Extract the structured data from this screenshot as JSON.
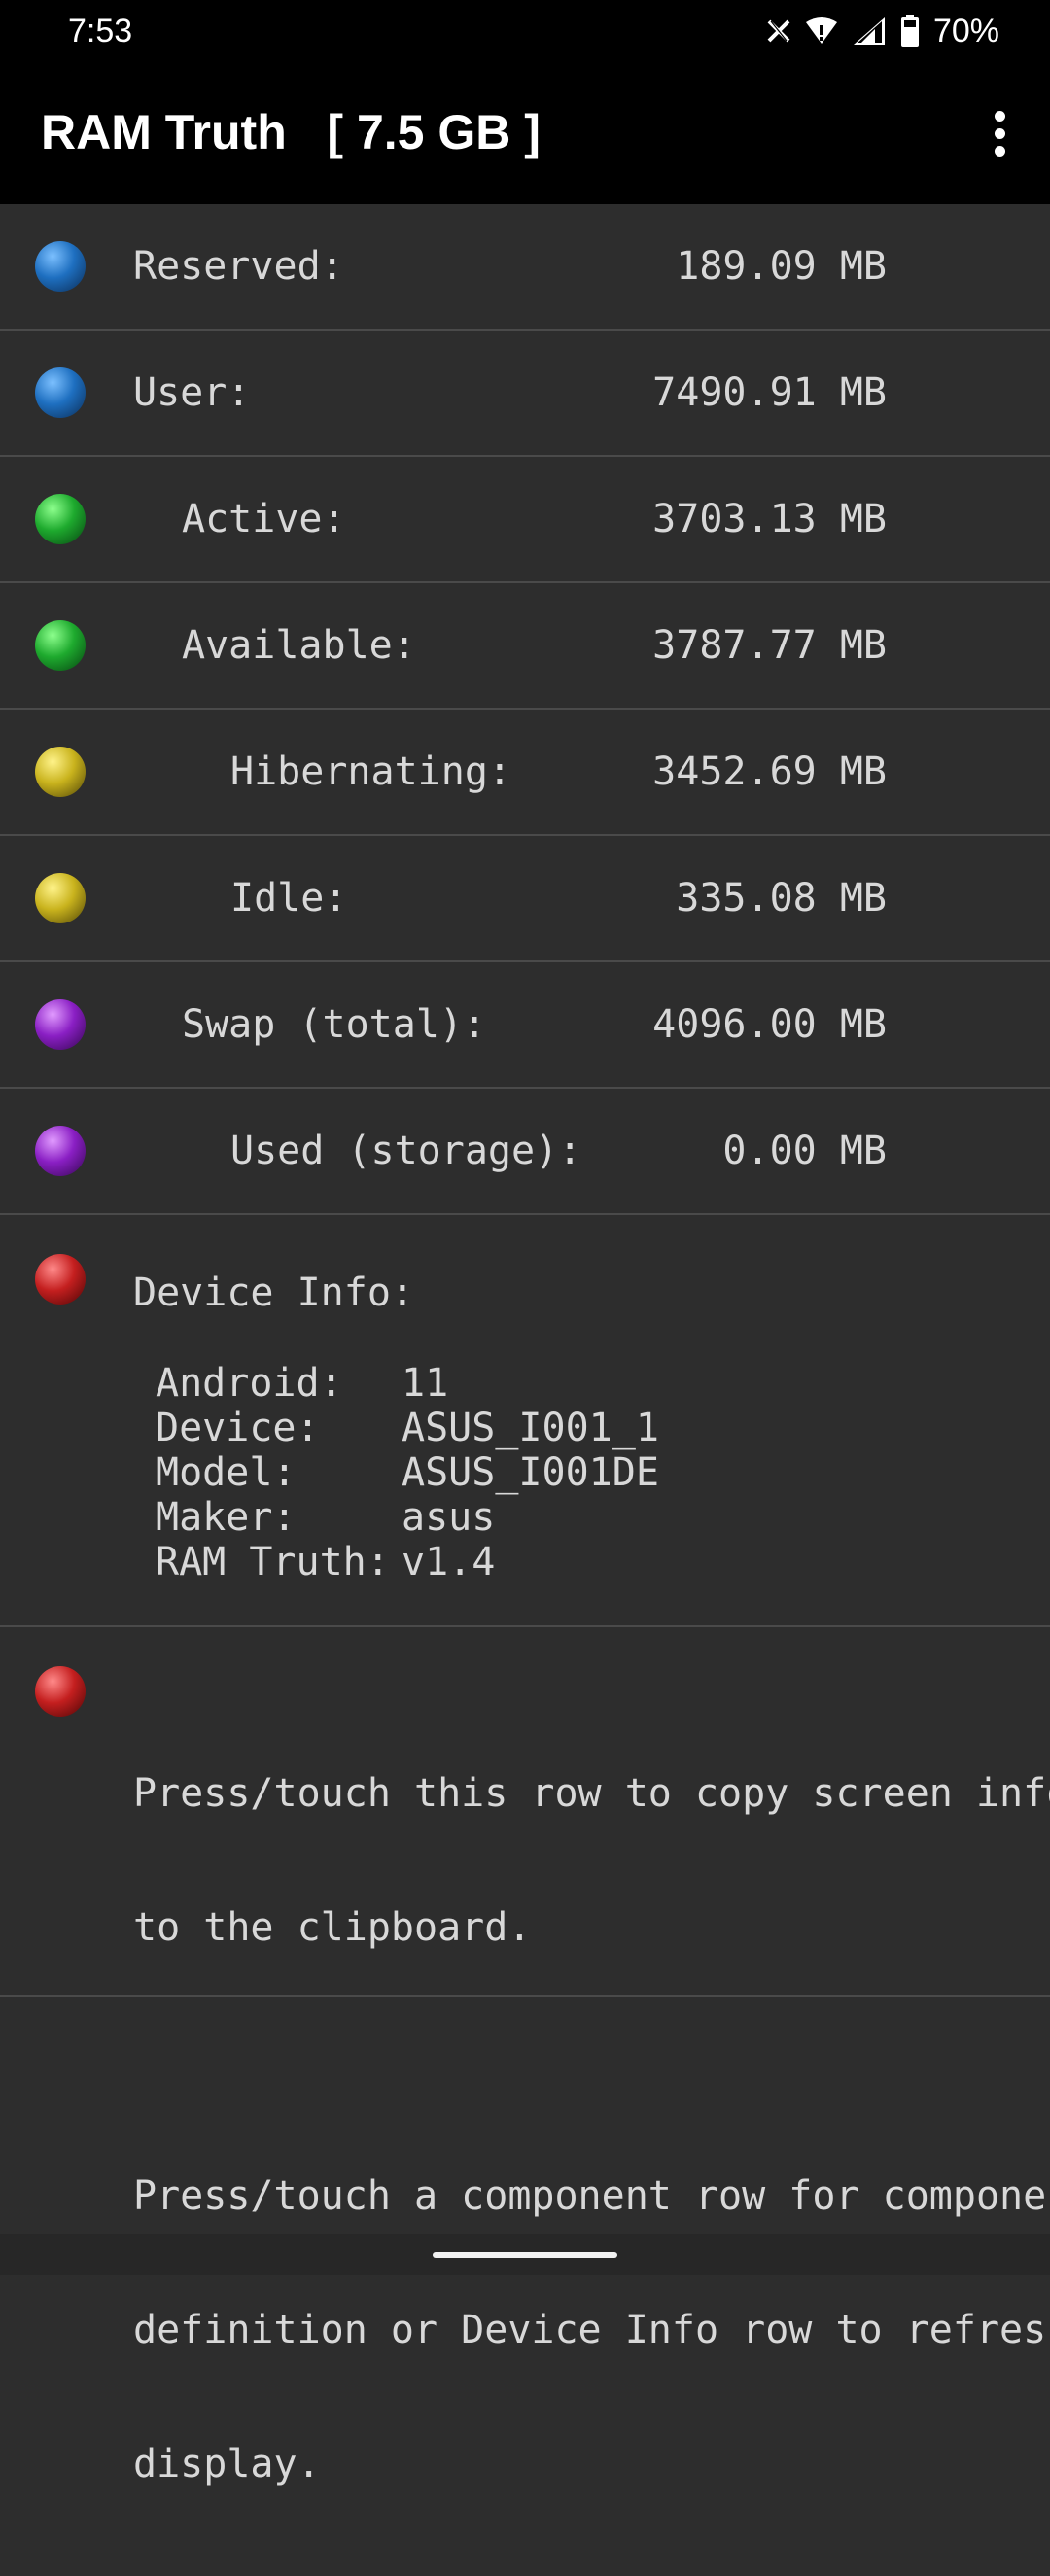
{
  "status_bar": {
    "time": "7:53",
    "battery": "70%",
    "icons": [
      "x-icon",
      "wifi-icon",
      "signal-icon",
      "battery-icon"
    ]
  },
  "app_bar": {
    "title": "RAM Truth   [ 7.5 GB ]",
    "menu_icon": "more-vert-icon"
  },
  "colors": {
    "blue": "#1e6fc0",
    "green": "#1eaa2e",
    "yellow": "#c9b31d",
    "purple": "#8a1fc4",
    "red": "#c41f1f",
    "background": "#2d2d2d",
    "divider": "#4a4a4a"
  },
  "memory_rows": [
    {
      "label": "Reserved:",
      "value": "189.09 MB",
      "color": "blue"
    },
    {
      "label": "User:",
      "value": "7490.91 MB",
      "color": "blue"
    },
    {
      "label": "Active:",
      "value": "3703.13 MB",
      "color": "green"
    },
    {
      "label": "Available:",
      "value": "3787.77 MB",
      "color": "green"
    },
    {
      "label": "Hibernating:",
      "value": "3452.69 MB",
      "color": "yellow"
    },
    {
      "label": "Idle:",
      "value": "335.08 MB",
      "color": "yellow"
    },
    {
      "label": "Swap (total):",
      "value": "4096.00 MB",
      "color": "purple"
    },
    {
      "label": "Used (storage):",
      "value": "0.00 MB",
      "color": "purple"
    }
  ],
  "device_info": {
    "heading": "Device Info:",
    "items": [
      {
        "key": "Android:",
        "value": "11"
      },
      {
        "key": "Device:",
        "value": "ASUS_I001_1"
      },
      {
        "key": "Model:",
        "value": "ASUS_I001DE"
      },
      {
        "key": "Maker:",
        "value": "asus"
      },
      {
        "key": "RAM Truth:",
        "value": "v1.4"
      }
    ]
  },
  "help": {
    "lines": [
      "Press/touch this row to copy screen info",
      "to the clipboard.",
      "",
      "Press/touch a component row for component",
      "definition or Device Info row to refresh",
      "display."
    ]
  }
}
